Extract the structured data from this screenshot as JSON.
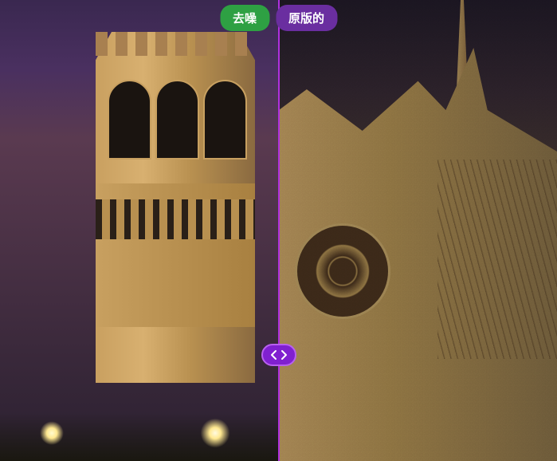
{
  "comparison": {
    "left_label": "去噪",
    "right_label": "原版的"
  },
  "slider": {
    "position_percent": 50
  },
  "colors": {
    "divider": "#b030e0",
    "handle_bg": "#8020d0",
    "handle_border": "#b860f0",
    "label_left_bg": "#2ea043",
    "label_right_bg": "#6a2ea0"
  }
}
